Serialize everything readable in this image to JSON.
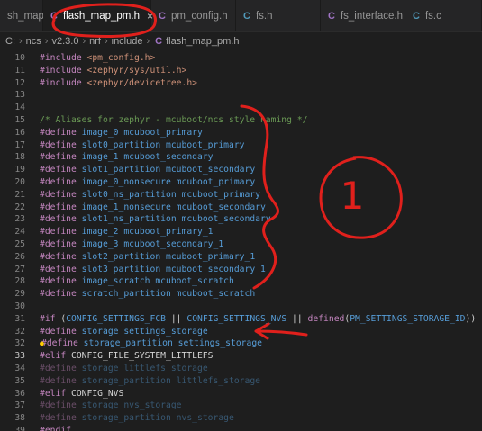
{
  "tabs": [
    {
      "label": "sh_map.h",
      "icon": "",
      "active": false
    },
    {
      "label": "flash_map_pm.h",
      "icon": "C",
      "active": true
    },
    {
      "label": "pm_config.h",
      "icon": "C",
      "active": false
    },
    {
      "label": "fs.h",
      "icon": "C",
      "active": false
    },
    {
      "label": "fs_interface.h",
      "icon": "C",
      "active": false
    },
    {
      "label": "fs.c",
      "icon": "C",
      "active": false
    }
  ],
  "tab_close_glyph": "×",
  "breadcrumb": {
    "parts": [
      "C:",
      "ncs",
      "v2.3.0",
      "nrf",
      "include"
    ],
    "file_icon": "C",
    "file": "flash_map_pm.h"
  },
  "editor": {
    "lines": [
      {
        "num": "10",
        "tokens": [
          {
            "t": "#include ",
            "c": "kw"
          },
          {
            "t": "<pm_config.h>",
            "c": "str"
          }
        ]
      },
      {
        "num": "11",
        "tokens": [
          {
            "t": "#include ",
            "c": "kw"
          },
          {
            "t": "<zephyr/sys/util.h>",
            "c": "str"
          }
        ]
      },
      {
        "num": "12",
        "tokens": [
          {
            "t": "#include ",
            "c": "kw"
          },
          {
            "t": "<zephyr/devicetree.h>",
            "c": "str"
          }
        ]
      },
      {
        "num": "13",
        "tokens": []
      },
      {
        "num": "14",
        "tokens": []
      },
      {
        "num": "15",
        "tokens": [
          {
            "t": "/* Aliases for zephyr - mcuboot/ncs style naming */",
            "c": "comment"
          }
        ]
      },
      {
        "num": "16",
        "tokens": [
          {
            "t": "#define ",
            "c": "kw"
          },
          {
            "t": "image_0",
            "c": "mac"
          },
          {
            "t": " mcuboot_primary",
            "c": "mac"
          }
        ]
      },
      {
        "num": "17",
        "tokens": [
          {
            "t": "#define ",
            "c": "kw"
          },
          {
            "t": "slot0_partition",
            "c": "mac"
          },
          {
            "t": " mcuboot_primary",
            "c": "mac"
          }
        ]
      },
      {
        "num": "18",
        "tokens": [
          {
            "t": "#define ",
            "c": "kw"
          },
          {
            "t": "image_1",
            "c": "mac"
          },
          {
            "t": " mcuboot_secondary",
            "c": "mac"
          }
        ]
      },
      {
        "num": "19",
        "tokens": [
          {
            "t": "#define ",
            "c": "kw"
          },
          {
            "t": "slot1_partition",
            "c": "mac"
          },
          {
            "t": " mcuboot_secondary",
            "c": "mac"
          }
        ]
      },
      {
        "num": "20",
        "tokens": [
          {
            "t": "#define ",
            "c": "kw"
          },
          {
            "t": "image_0_nonsecure",
            "c": "mac"
          },
          {
            "t": " mcuboot_primary",
            "c": "mac"
          }
        ]
      },
      {
        "num": "21",
        "tokens": [
          {
            "t": "#define ",
            "c": "kw"
          },
          {
            "t": "slot0_ns_partition",
            "c": "mac"
          },
          {
            "t": " mcuboot_primary",
            "c": "mac"
          }
        ]
      },
      {
        "num": "22",
        "tokens": [
          {
            "t": "#define ",
            "c": "kw"
          },
          {
            "t": "image_1_nonsecure",
            "c": "mac"
          },
          {
            "t": " mcuboot_secondary",
            "c": "mac"
          }
        ]
      },
      {
        "num": "23",
        "tokens": [
          {
            "t": "#define ",
            "c": "kw"
          },
          {
            "t": "slot1_ns_partition",
            "c": "mac"
          },
          {
            "t": " mcuboot_secondary",
            "c": "mac"
          }
        ]
      },
      {
        "num": "24",
        "tokens": [
          {
            "t": "#define ",
            "c": "kw"
          },
          {
            "t": "image_2",
            "c": "mac"
          },
          {
            "t": " mcuboot_primary_1",
            "c": "mac"
          }
        ]
      },
      {
        "num": "25",
        "tokens": [
          {
            "t": "#define ",
            "c": "kw"
          },
          {
            "t": "image_3",
            "c": "mac"
          },
          {
            "t": " mcuboot_secondary_1",
            "c": "mac"
          }
        ]
      },
      {
        "num": "26",
        "tokens": [
          {
            "t": "#define ",
            "c": "kw"
          },
          {
            "t": "slot2_partition",
            "c": "mac"
          },
          {
            "t": " mcuboot_primary_1",
            "c": "mac"
          }
        ]
      },
      {
        "num": "27",
        "tokens": [
          {
            "t": "#define ",
            "c": "kw"
          },
          {
            "t": "slot3_partition",
            "c": "mac"
          },
          {
            "t": " mcuboot_secondary_1",
            "c": "mac"
          }
        ]
      },
      {
        "num": "28",
        "tokens": [
          {
            "t": "#define ",
            "c": "kw"
          },
          {
            "t": "image_scratch",
            "c": "mac"
          },
          {
            "t": " mcuboot_scratch",
            "c": "mac"
          }
        ]
      },
      {
        "num": "29",
        "tokens": [
          {
            "t": "#define ",
            "c": "kw"
          },
          {
            "t": "scratch_partition",
            "c": "mac"
          },
          {
            "t": " mcuboot_scratch",
            "c": "mac"
          }
        ]
      },
      {
        "num": "30",
        "tokens": []
      },
      {
        "num": "31",
        "tokens": [
          {
            "t": "#if ",
            "c": "kw"
          },
          {
            "t": "(",
            "c": "plain"
          },
          {
            "t": "CONFIG_SETTINGS_FCB",
            "c": "mac"
          },
          {
            "t": " || ",
            "c": "plain"
          },
          {
            "t": "CONFIG_SETTINGS_NVS",
            "c": "mac"
          },
          {
            "t": " || ",
            "c": "plain"
          },
          {
            "t": "defined",
            "c": "kw"
          },
          {
            "t": "(",
            "c": "plain"
          },
          {
            "t": "PM_SETTINGS_STORAGE_ID",
            "c": "mac"
          },
          {
            "t": "))",
            "c": "plain"
          }
        ]
      },
      {
        "num": "32",
        "tokens": [
          {
            "t": "#define ",
            "c": "kw"
          },
          {
            "t": "storage",
            "c": "mac"
          },
          {
            "t": " settings_storage",
            "c": "mac"
          }
        ]
      },
      {
        "num": "32",
        "bulb": true,
        "tokens": [
          {
            "t": "#define ",
            "c": "kw"
          },
          {
            "t": "storage_partition",
            "c": "mac"
          },
          {
            "t": " settings_storage",
            "c": "mac"
          }
        ]
      },
      {
        "num": "33",
        "current": true,
        "tokens": [
          {
            "t": "#elif ",
            "c": "kw"
          },
          {
            "t": "CONFIG_FILE_SYSTEM_LITTLEFS",
            "c": "plain"
          }
        ]
      },
      {
        "num": "34",
        "dim": true,
        "tokens": [
          {
            "t": "#define ",
            "c": "kw"
          },
          {
            "t": "storage",
            "c": "mac"
          },
          {
            "t": " littlefs_storage",
            "c": "mac"
          }
        ]
      },
      {
        "num": "35",
        "dim": true,
        "tokens": [
          {
            "t": "#define ",
            "c": "kw"
          },
          {
            "t": "storage_partition",
            "c": "mac"
          },
          {
            "t": " littlefs_storage",
            "c": "mac"
          }
        ]
      },
      {
        "num": "36",
        "tokens": [
          {
            "t": "#elif ",
            "c": "kw"
          },
          {
            "t": "CONFIG_NVS",
            "c": "plain"
          }
        ]
      },
      {
        "num": "37",
        "dim": true,
        "tokens": [
          {
            "t": "#define ",
            "c": "kw"
          },
          {
            "t": "storage",
            "c": "mac"
          },
          {
            "t": " nvs_storage",
            "c": "mac"
          }
        ]
      },
      {
        "num": "38",
        "dim": true,
        "tokens": [
          {
            "t": "#define ",
            "c": "kw"
          },
          {
            "t": "storage_partition",
            "c": "mac"
          },
          {
            "t": " nvs_storage",
            "c": "mac"
          }
        ]
      },
      {
        "num": "39",
        "tokens": [
          {
            "t": "#endif",
            "c": "kw"
          }
        ]
      }
    ]
  },
  "annotations": {
    "label": "1",
    "color": "#e0201c"
  }
}
